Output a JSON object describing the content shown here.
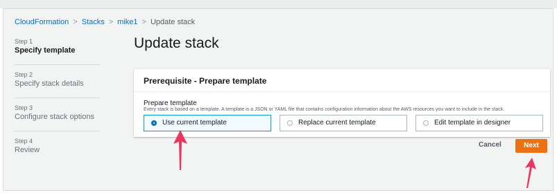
{
  "breadcrumb": {
    "items": [
      "CloudFormation",
      "Stacks",
      "mike1"
    ],
    "current": "Update stack",
    "separator": ">"
  },
  "nav": {
    "steps": [
      {
        "number": "Step 1",
        "label": "Specify template"
      },
      {
        "number": "Step 2",
        "label": "Specify stack details"
      },
      {
        "number": "Step 3",
        "label": "Configure stack options"
      },
      {
        "number": "Step 4",
        "label": "Review"
      }
    ],
    "active_step": 1
  },
  "page": {
    "title": "Update stack"
  },
  "panel": {
    "title": "Prerequisite - Prepare template",
    "field_label": "Prepare template",
    "field_description": "Every stack is based on a template. A template is a JSON or YAML file that contains configuration information about the AWS resources you want to include in the stack.",
    "options": [
      {
        "label": "Use current template",
        "selected": true
      },
      {
        "label": "Replace current template",
        "selected": false
      },
      {
        "label": "Edit template in designer",
        "selected": false
      }
    ]
  },
  "actions": {
    "cancel_label": "Cancel",
    "next_label": "Next"
  },
  "colors": {
    "link": "#0073bb",
    "primary_button": "#ec7211",
    "selected_border": "#00a1c9",
    "annotation_arrow": "#e8365d"
  }
}
